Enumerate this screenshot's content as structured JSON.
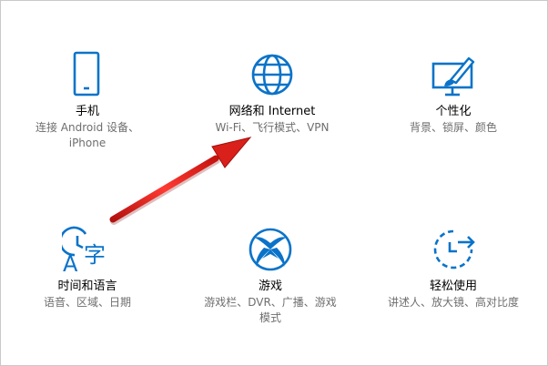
{
  "accent_color": "#0a73c9",
  "arrow_color": "#e0201c",
  "tiles": [
    {
      "icon": "phone-icon",
      "title": "手机",
      "desc_lines": [
        "连接 Android 设备、",
        "iPhone"
      ]
    },
    {
      "icon": "globe-icon",
      "title": "网络和 Internet",
      "desc_lines": [
        "Wi-Fi、飞行模式、VPN"
      ]
    },
    {
      "icon": "personalization-icon",
      "title": "个性化",
      "desc_lines": [
        "背景、锁屏、颜色"
      ]
    },
    {
      "icon": "time-language-icon",
      "title": "时间和语言",
      "desc_lines": [
        "语音、区域、日期"
      ]
    },
    {
      "icon": "xbox-icon",
      "title": "游戏",
      "desc_lines": [
        "游戏栏、DVR、广播、游戏",
        "模式"
      ]
    },
    {
      "icon": "ease-of-access-icon",
      "title": "轻松使用",
      "desc_lines": [
        "讲述人、放大镜、高对比度"
      ]
    }
  ],
  "icon_glyphs": {
    "time_language_char": "字",
    "time_language_letter": "A"
  }
}
